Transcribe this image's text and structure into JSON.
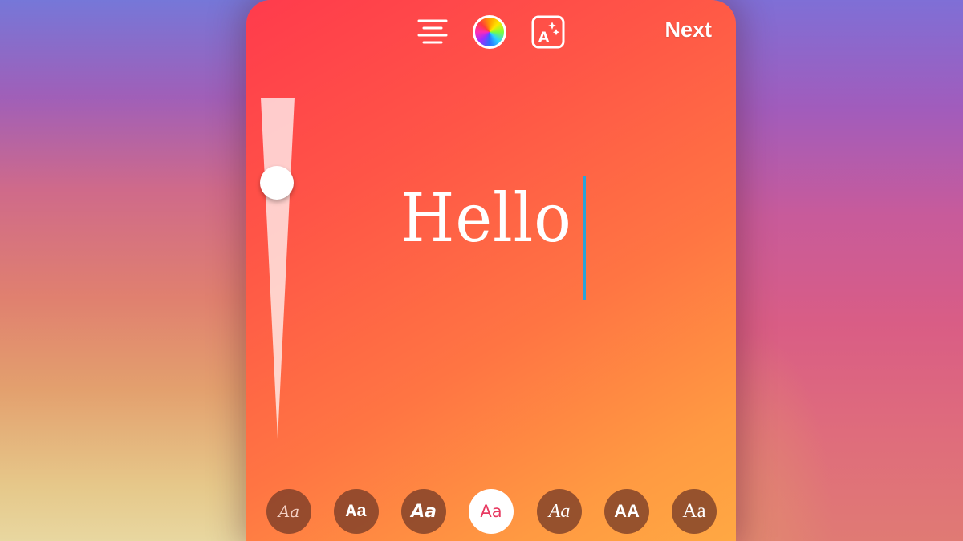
{
  "toolbar": {
    "align_icon": "align-center-icon",
    "color_icon": "color-wheel-icon",
    "effects_icon": "text-effects-sparkle-icon",
    "next_label": "Next"
  },
  "editor": {
    "text": "Hello",
    "caret_color": "#2aa3d9",
    "text_color": "#ffffff"
  },
  "size_slider": {
    "value_percent": 78
  },
  "fonts": [
    {
      "label": "Aa",
      "style": "script",
      "selected": false
    },
    {
      "label": "Aa",
      "style": "typewriter",
      "selected": false
    },
    {
      "label": "Aa",
      "style": "bold-italic",
      "selected": false
    },
    {
      "label": "Aa",
      "style": "handwritten",
      "selected": true
    },
    {
      "label": "Aa",
      "style": "serif-italic",
      "selected": false
    },
    {
      "label": "AA",
      "style": "bold-caps",
      "selected": false
    },
    {
      "label": "Aa",
      "style": "classic-serif",
      "selected": false
    }
  ],
  "colors": {
    "selected_font_text": "#e83a62",
    "font_button_bg": "#7a3c28"
  }
}
